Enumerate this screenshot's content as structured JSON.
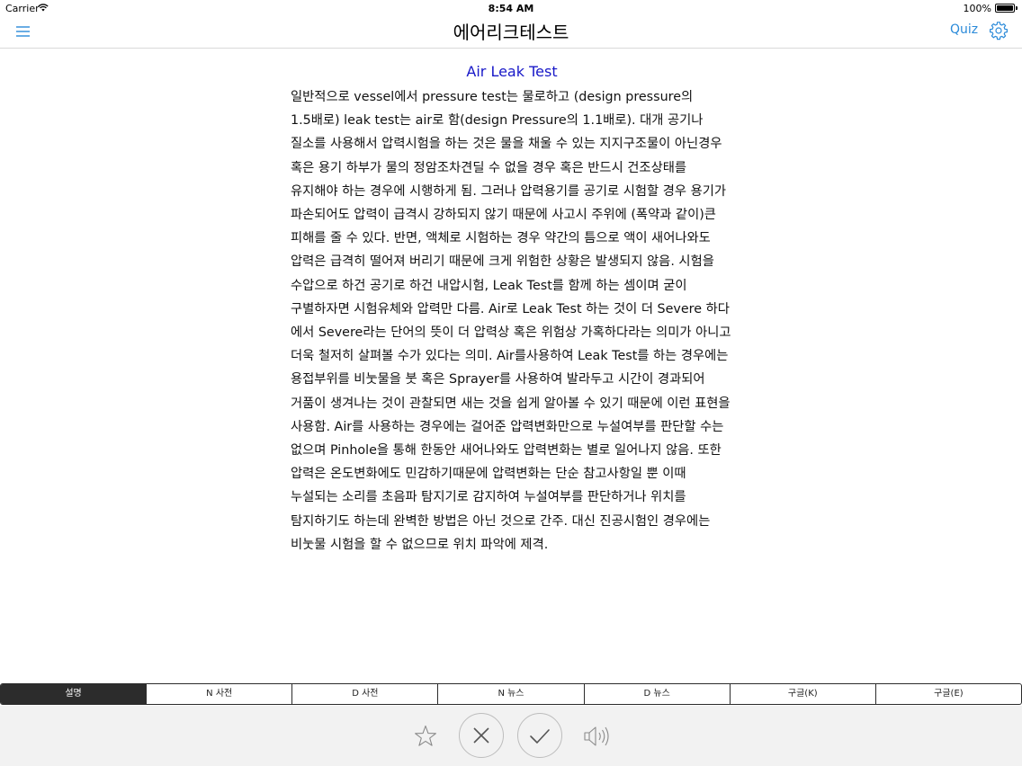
{
  "status_bar": {
    "carrier": "Carrier",
    "time": "8:54 AM",
    "battery_percent": "100%"
  },
  "nav": {
    "title": "에어리크테스트",
    "quiz_label": "Quiz",
    "accent_color": "#2a8ad9"
  },
  "content": {
    "title": "Air Leak Test",
    "body": "일반적으로 vessel에서 pressure test는 물로하고 (design pressure의 1.5배로) leak test는 air로 함(design Pressure의 1.1배로). 대개 공기나 질소를 사용해서 압력시험을 하는 것은 물을 채울 수 있는 지지구조물이 아닌경우 혹은 용기 하부가 물의 정암조차견딜 수 없을 경우 혹은 반드시 건조상태를 유지해야 하는 경우에 시행하게 됨. 그러나 압력용기를 공기로 시험할 경우 용기가 파손되어도 압력이 급격시 강하되지 않기 때문에 사고시 주위에 (폭약과 같이)큰 피해를 줄 수 있다. 반면, 액체로 시험하는 경우 약간의 틈으로 액이 새어나와도 압력은 급격히 떨어져 버리기 때문에 크게 위험한 상황은 발생되지 않음. 시험을 수압으로 하건 공기로 하건 내압시험, Leak Test를 함께 하는 셈이며 굳이 구별하자면 시험유체와 압력만 다름. Air로 Leak Test 하는 것이 더 Severe 하다 에서 Severe라는 단어의 뜻이 더 압력상 혹은 위험상 가혹하다라는 의미가 아니고 더욱 철저히 살펴볼 수가 있다는 의미. Air를사용하여 Leak Test를 하는 경우에는 용접부위를 비눗물을 붓 혹은 Sprayer를 사용하여 발라두고 시간이 경과되어 거품이 생겨나는 것이 관찰되면 새는 것을 쉽게 알아볼 수 있기 때문에 이런 표현을 사용함. Air를 사용하는 경우에는 걸어준 압력변화만으로 누설여부를 판단할 수는 없으며 Pinhole을 통해 한동안 새어나와도 압력변화는 별로 일어나지 않음. 또한 압력은 온도변화에도 민감하기때문에 압력변화는 단순 참고사항일 뿐 이때 누설되는 소리를 초음파 탐지기로 감지하여 누설여부를 판단하거나 위치를 탐지하기도 하는데 완벽한 방법은 아닌 것으로 간주. 대신 진공시험인 경우에는 비눗물 시험을 할 수 없으므로 위치 파악에 제격.",
    "title_color": "#1818c8"
  },
  "tabs": [
    {
      "label": "설명",
      "active": true
    },
    {
      "label": "N 사전",
      "active": false
    },
    {
      "label": "D 사전",
      "active": false
    },
    {
      "label": "N 뉴스",
      "active": false
    },
    {
      "label": "D 뉴스",
      "active": false
    },
    {
      "label": "구글(K)",
      "active": false
    },
    {
      "label": "구글(E)",
      "active": false
    }
  ],
  "toolbar": {
    "icons": [
      "star-icon",
      "close-icon",
      "checkmark-icon",
      "speaker-icon"
    ]
  }
}
